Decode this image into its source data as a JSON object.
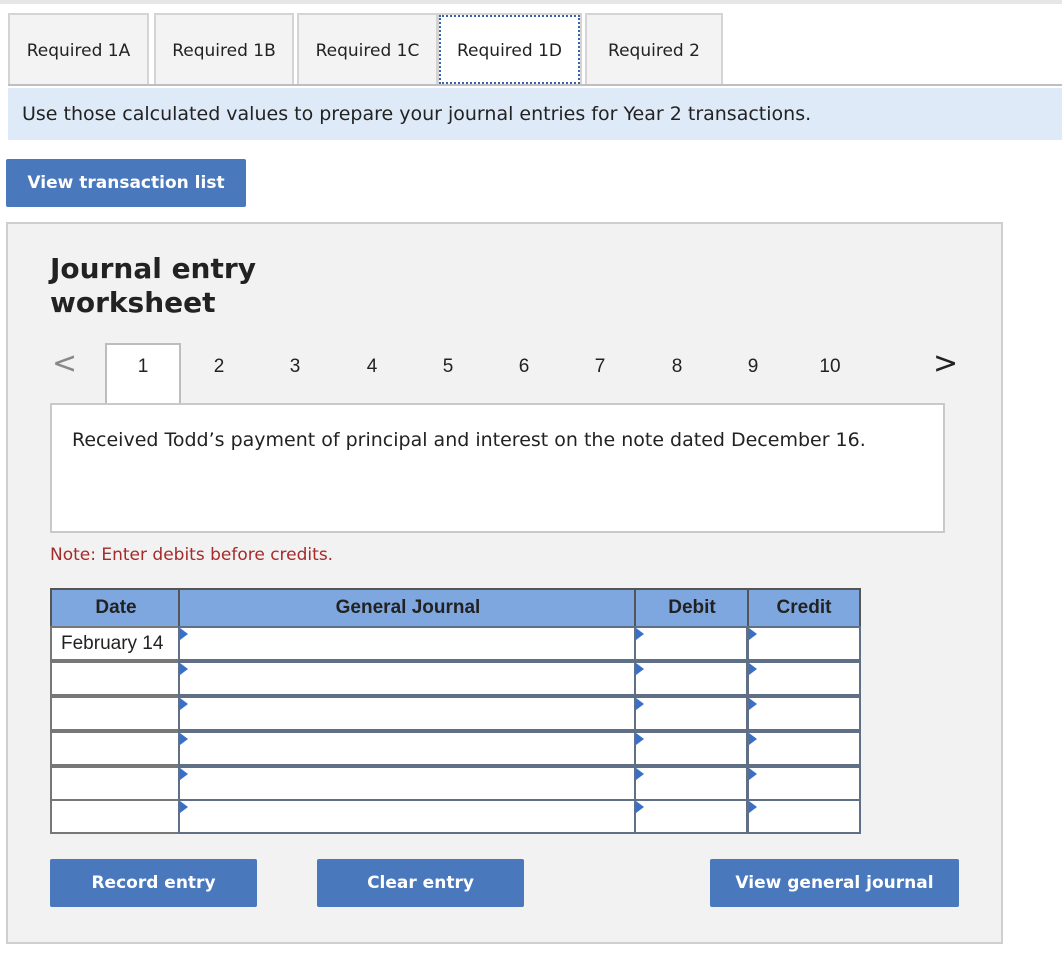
{
  "tabs": [
    "Required 1A",
    "Required 1B",
    "Required 1C",
    "Required 1D",
    "Required 2"
  ],
  "active_tab": "Required 1D",
  "instruction": "Use those calculated values to prepare your journal entries for Year 2 transactions.",
  "view_transactions_label": "View transaction list",
  "worksheet": {
    "title_line1": "Journal entry",
    "title_line2": "worksheet",
    "pager": {
      "prev": "<",
      "next": ">",
      "pages": [
        "1",
        "2",
        "3",
        "4",
        "5",
        "6",
        "7",
        "8",
        "9",
        "10"
      ],
      "current": "1"
    },
    "description": "Received Todd’s payment of principal and interest on the note dated December 16.",
    "note": "Note: Enter debits before credits.",
    "table": {
      "headers": {
        "date": "Date",
        "journal": "General Journal",
        "debit": "Debit",
        "credit": "Credit"
      },
      "rows": [
        {
          "date": "February 14",
          "account": "",
          "debit": "",
          "credit": ""
        },
        {
          "date": "",
          "account": "",
          "debit": "",
          "credit": ""
        },
        {
          "date": "",
          "account": "",
          "debit": "",
          "credit": ""
        },
        {
          "date": "",
          "account": "",
          "debit": "",
          "credit": ""
        },
        {
          "date": "",
          "account": "",
          "debit": "",
          "credit": ""
        },
        {
          "date": "",
          "account": "",
          "debit": "",
          "credit": ""
        }
      ]
    },
    "buttons": {
      "record": "Record entry",
      "clear": "Clear entry",
      "view_journal": "View general journal"
    }
  },
  "colors": {
    "button_blue": "#4a78bd",
    "header_blue": "#7fa7df",
    "banner_blue": "#deeaf7",
    "note_red": "#a52a2a"
  }
}
